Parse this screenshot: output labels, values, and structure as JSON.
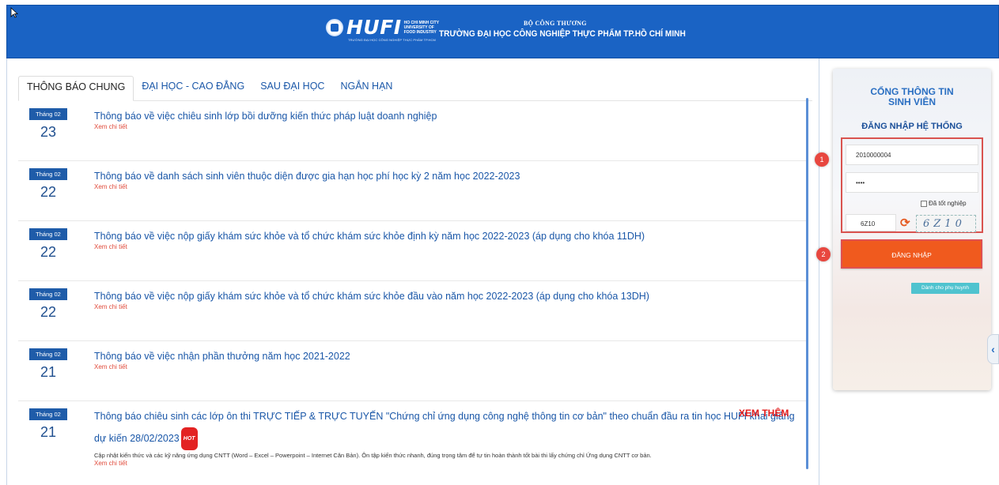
{
  "header": {
    "logo_text": "HUFI",
    "logo_small_lines": [
      "HO CHI MINH CITY",
      "UNIVERSITY OF",
      "FOOD INDUSTRY"
    ],
    "logo_sub": "TRƯỜNG ĐẠI HỌC CÔNG NGHIỆP THỰC PHẨM TP.HCM",
    "ministry": "BỘ CÔNG THƯƠNG",
    "university": "TRƯỜNG ĐẠI HỌC CÔNG NGHIỆP THỰC PHẨM TP.HỒ CHÍ MINH",
    "bg_color": "#1a63c4"
  },
  "tabs": [
    {
      "label": "THÔNG BÁO CHUNG",
      "active": true
    },
    {
      "label": "ĐẠI HỌC - CAO ĐẲNG",
      "active": false
    },
    {
      "label": "SAU ĐẠI HỌC",
      "active": false
    },
    {
      "label": "NGẮN HẠN",
      "active": false
    }
  ],
  "news": [
    {
      "month": "Tháng 02",
      "day": "23",
      "title": "Thông báo về việc chiêu sinh lớp bồi dưỡng kiến thức pháp luật doanh nghiệp",
      "more": "Xem chi tiết"
    },
    {
      "month": "Tháng 02",
      "day": "22",
      "title": "Thông báo về danh sách sinh viên thuộc diện được gia hạn học phí học kỳ 2 năm học 2022-2023",
      "more": "Xem chi tiết"
    },
    {
      "month": "Tháng 02",
      "day": "22",
      "title": "Thông báo về việc nộp giấy khám sức khỏe và tổ chức khám sức khỏe định kỳ năm học 2022-2023 (áp dụng cho khóa 11DH)",
      "more": "Xem chi tiết"
    },
    {
      "month": "Tháng 02",
      "day": "22",
      "title": "Thông báo về việc nộp giấy khám sức khỏe và tổ chức khám sức khỏe đầu vào năm học 2022-2023 (áp dụng cho khóa 13DH)",
      "more": "Xem chi tiết"
    },
    {
      "month": "Tháng 02",
      "day": "21",
      "title": "Thông báo về việc nhận phần thưởng năm học 2021-2022",
      "more": "Xem chi tiết"
    },
    {
      "month": "Tháng 02",
      "day": "21",
      "title": "Thông báo chiêu sinh các lớp ôn thi TRỰC TIẾP & TRỰC TUYẾN \"Chứng chỉ ứng dụng công nghệ thông tin cơ bản\" theo chuẩn đầu ra tin học HUFI khai giảng dự kiến 28/02/2023",
      "hot": "HOT",
      "desc": "Cập nhật kiến thức và các kỹ năng ứng dụng CNTT (Word – Excel – Powerpoint – Internet Căn Bản). Ôn tập kiến thức nhanh, đúng trọng tâm để tự tin hoàn thành tốt bài thi lấy chứng chỉ Ứng dụng CNTT cơ bản.",
      "more": "Xem chi tiết"
    }
  ],
  "see_more": "XEM THÊM",
  "login": {
    "title_line1": "CỔNG THÔNG TIN",
    "title_line2": "SINH VIÊN",
    "subtitle": "ĐĂNG NHẬP HỆ THỐNG",
    "username_value": "2010000004",
    "password_value": "••••",
    "graduated_label": "Đã tốt nghiệp",
    "captcha_value": "6Z10",
    "captcha_image_text": "6Z10",
    "login_button": "ĐĂNG NHẬP",
    "parent_button": "Dành cho phụ huynh",
    "annotation_1": "1",
    "annotation_2": "2"
  }
}
